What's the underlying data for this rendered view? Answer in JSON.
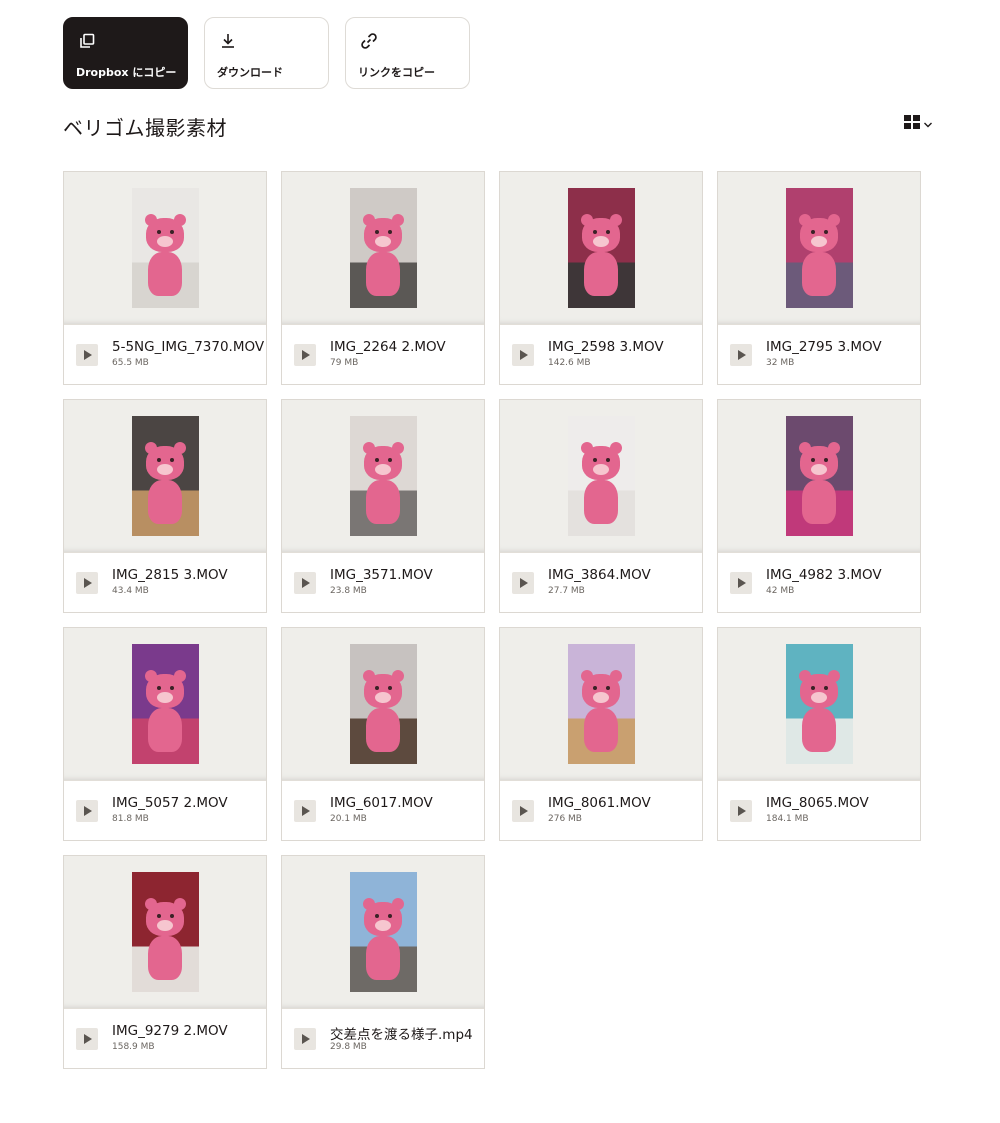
{
  "actions": [
    {
      "label": "Dropbox にコピー",
      "icon": "copy-icon"
    },
    {
      "label": "ダウンロード",
      "icon": "download-icon"
    },
    {
      "label": "リンクをコピー",
      "icon": "link-icon"
    }
  ],
  "folder": {
    "title": "ベリゴム撮影素材"
  },
  "view_toggle": {
    "icon": "grid-view-icon"
  },
  "colors": {
    "accent_dark": "#1e1919",
    "bear_pink": "#e3668f",
    "thumb_bg": "#efeeea"
  },
  "files": [
    {
      "name": "5-5NG_IMG_7370.MOV",
      "size": "65.5 MB",
      "bg": "#e9e7e4",
      "floor": "#d8d5d0"
    },
    {
      "name": "IMG_2264 2.MOV",
      "size": "79 MB",
      "bg": "#cfcac6",
      "floor": "#5b5855"
    },
    {
      "name": "IMG_2598 3.MOV",
      "size": "142.6 MB",
      "bg": "#8d2f4a",
      "floor": "#3e3638"
    },
    {
      "name": "IMG_2795 3.MOV",
      "size": "32 MB",
      "bg": "#b0406e",
      "floor": "#6c5a7a"
    },
    {
      "name": "IMG_2815 3.MOV",
      "size": "43.4 MB",
      "bg": "#4b4543",
      "floor": "#b88f62"
    },
    {
      "name": "IMG_3571.MOV",
      "size": "23.8 MB",
      "bg": "#ddd8d4",
      "floor": "#7a7674"
    },
    {
      "name": "IMG_3864.MOV",
      "size": "27.7 MB",
      "bg": "#eeeceb",
      "floor": "#e4e1de"
    },
    {
      "name": "IMG_4982 3.MOV",
      "size": "42 MB",
      "bg": "#6c4a6e",
      "floor": "#c0397a"
    },
    {
      "name": "IMG_5057 2.MOV",
      "size": "81.8 MB",
      "bg": "#7a3a8c",
      "floor": "#c2426e"
    },
    {
      "name": "IMG_6017.MOV",
      "size": "20.1 MB",
      "bg": "#c7c2c0",
      "floor": "#5d4a3e"
    },
    {
      "name": "IMG_8061.MOV",
      "size": "276 MB",
      "bg": "#c9b4d8",
      "floor": "#c9a070"
    },
    {
      "name": "IMG_8065.MOV",
      "size": "184.1 MB",
      "bg": "#5fb3c1",
      "floor": "#dfe8e6"
    },
    {
      "name": "IMG_9279 2.MOV",
      "size": "158.9 MB",
      "bg": "#8d2530",
      "floor": "#e2dcd8"
    },
    {
      "name": "交差点を渡る様子.mp4",
      "size": "29.8 MB",
      "bg": "#8fb4d8",
      "floor": "#6e6a66"
    }
  ]
}
